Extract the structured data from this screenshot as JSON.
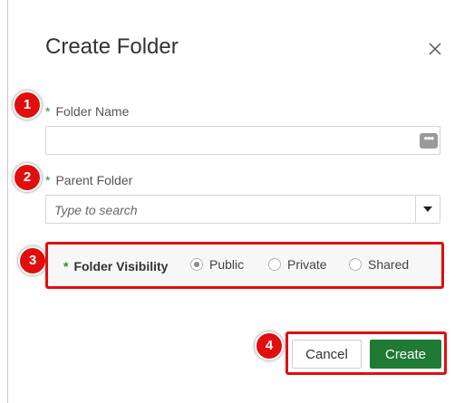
{
  "dialog": {
    "title": "Create Folder"
  },
  "fields": {
    "required_marker": "*",
    "folder_name": {
      "label": "Folder Name",
      "value": ""
    },
    "parent_folder": {
      "label": "Parent Folder",
      "placeholder": "Type to search"
    },
    "visibility": {
      "label": "Folder Visibility",
      "options": [
        "Public",
        "Private",
        "Shared"
      ],
      "selected": "Public"
    }
  },
  "buttons": {
    "cancel": "Cancel",
    "create": "Create"
  },
  "badges": [
    "1",
    "2",
    "3",
    "4"
  ],
  "colors": {
    "badge": "#e10e0e",
    "primary_button": "#1f7a34",
    "required_asterisk": "#2e8a3f"
  },
  "icons": {
    "close": "close-icon",
    "more": "more-dots-icon",
    "dropdown": "caret-down-icon"
  }
}
